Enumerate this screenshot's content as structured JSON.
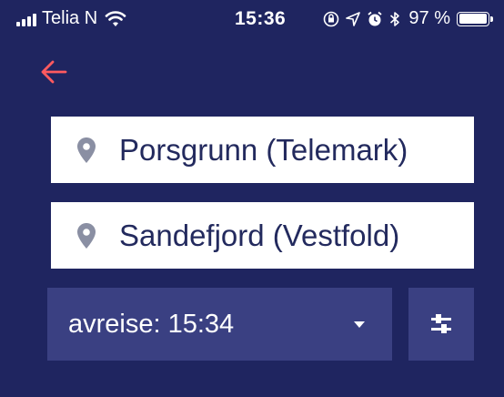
{
  "status_bar": {
    "carrier": "Telia N",
    "time": "15:36",
    "battery_percent": "97 %",
    "battery_level": 0.97,
    "icons": [
      "signal-icon",
      "wifi-icon",
      "orientation-lock-icon",
      "location-icon",
      "alarm-icon",
      "bluetooth-icon",
      "battery-icon"
    ]
  },
  "nav": {
    "back_icon": "arrow-left-icon",
    "accent_color": "#ff5a5f"
  },
  "search": {
    "from": "Porsgrunn (Telemark)",
    "to": "Sandefjord (Vestfold)",
    "departure_label": "avreise: 15:34",
    "pin_icon": "location-pin-icon",
    "filter_icon": "filter-sliders-icon"
  },
  "colors": {
    "background": "#1f2560",
    "control_bg": "#3a4082",
    "field_text": "#232a5e",
    "pin": "#8a8fa3"
  }
}
